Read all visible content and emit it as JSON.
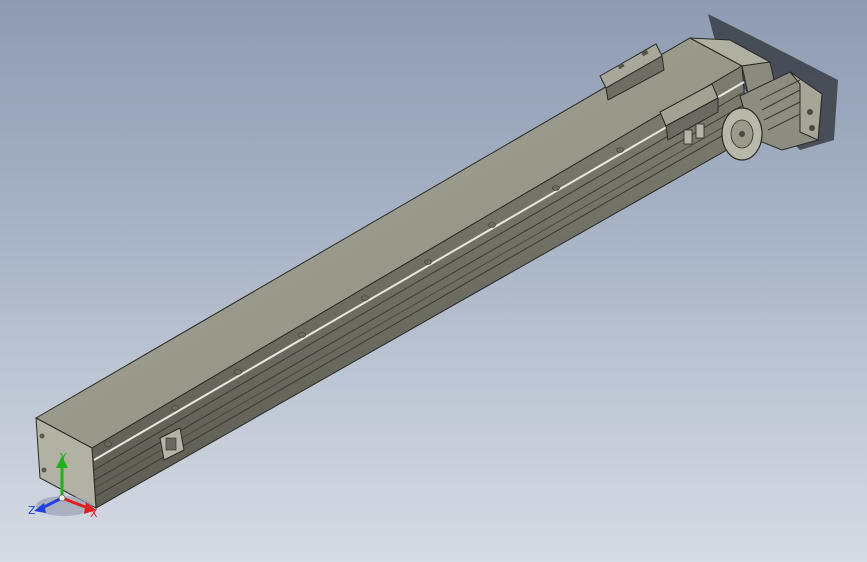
{
  "viewport": {
    "background_top": "#8e9bb2",
    "background_bottom": "#d6dbe4"
  },
  "model": {
    "body_color": "#9a9a8a",
    "edge_color": "#2a2a26",
    "motor_color": "#8c8c80"
  },
  "triad": {
    "x_label": "X",
    "y_label": "Y",
    "z_label": "Z",
    "x_color": "#e02020",
    "y_color": "#20b020",
    "z_color": "#2040e0"
  }
}
